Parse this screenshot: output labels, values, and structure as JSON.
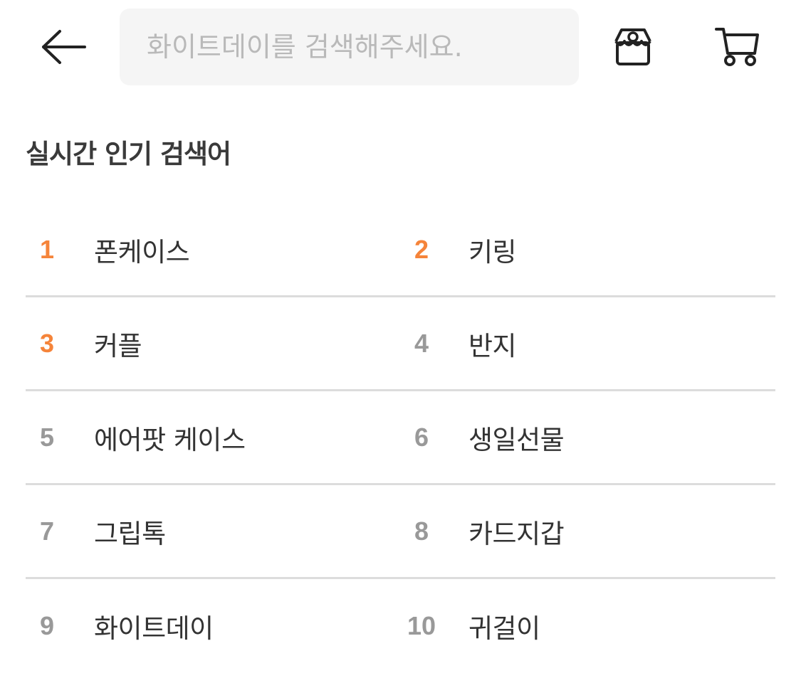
{
  "header": {
    "back_icon": "arrow-left-icon",
    "search_placeholder": "화이트데이를 검색해주세요.",
    "store_icon": "store-icon",
    "cart_icon": "cart-icon"
  },
  "section": {
    "title": "실시간 인기 검색어"
  },
  "accent_color": "#f5843a",
  "rank_rows": [
    [
      {
        "rank": "1",
        "term": "폰케이스",
        "top": true
      },
      {
        "rank": "2",
        "term": "키링",
        "top": true
      }
    ],
    [
      {
        "rank": "3",
        "term": "커플",
        "top": true
      },
      {
        "rank": "4",
        "term": "반지",
        "top": false
      }
    ],
    [
      {
        "rank": "5",
        "term": "에어팟 케이스",
        "top": false
      },
      {
        "rank": "6",
        "term": "생일선물",
        "top": false
      }
    ],
    [
      {
        "rank": "7",
        "term": "그립톡",
        "top": false
      },
      {
        "rank": "8",
        "term": "카드지갑",
        "top": false
      }
    ],
    [
      {
        "rank": "9",
        "term": "화이트데이",
        "top": false
      },
      {
        "rank": "10",
        "term": "귀걸이",
        "top": false
      }
    ]
  ]
}
